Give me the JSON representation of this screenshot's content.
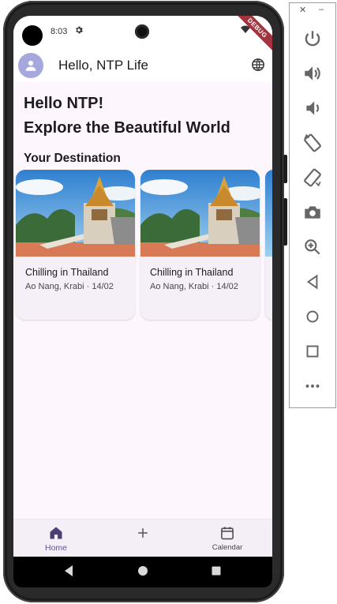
{
  "status_bar": {
    "time": "8:03",
    "debug_ribbon": "DEBUG"
  },
  "app_bar": {
    "greeting": "Hello, NTP Life"
  },
  "main": {
    "heading_line1": "Hello NTP!",
    "heading_line2": "Explore the Beautiful World",
    "section_title": "Your Destination",
    "cards": [
      {
        "title": "Chilling in Thailand",
        "subtitle": "Ao Nang, Krabi · 14/02"
      },
      {
        "title": "Chilling in Thailand",
        "subtitle": "Ao Nang, Krabi · 14/02"
      }
    ]
  },
  "bottom_nav": {
    "items": [
      {
        "label": "Home",
        "icon": "home-icon",
        "selected": true
      },
      {
        "label": "",
        "icon": "add-icon",
        "selected": false
      },
      {
        "label": "Calendar",
        "icon": "calendar-icon",
        "selected": false
      }
    ]
  },
  "emulator_panel": {
    "window_controls": [
      "close-icon",
      "minimize-icon"
    ],
    "buttons": [
      "power-icon",
      "volume-up-icon",
      "volume-down-icon",
      "rotate-left-icon",
      "rotate-right-icon",
      "camera-icon",
      "zoom-icon",
      "back-icon",
      "home-circle-icon",
      "overview-icon",
      "more-icon"
    ]
  },
  "colors": {
    "accent": "#6750a4",
    "surface": "#fdf7fd",
    "card": "#f5eff7",
    "avatar": "#a5a7dd",
    "ribbon": "#a3343e"
  }
}
